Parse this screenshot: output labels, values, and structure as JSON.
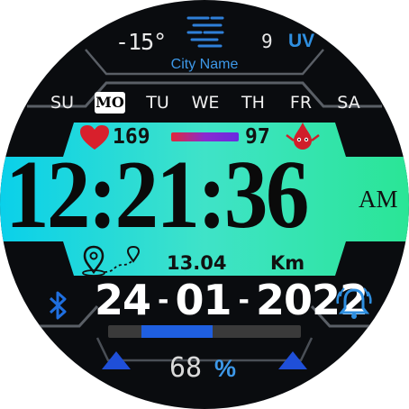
{
  "weather": {
    "temperature": "-15°",
    "uv_value": "9",
    "uv_label": "UV",
    "city": "City Name",
    "icon": "fog-icon"
  },
  "weekdays": [
    "SU",
    "MO",
    "TU",
    "WE",
    "TH",
    "FR",
    "SA"
  ],
  "active_day": "MO",
  "health": {
    "heart_rate": "169",
    "heart_icon": "heart-icon",
    "oxygen": "97",
    "oxygen_icon": "blood-drop-icon"
  },
  "time": {
    "display": "12:21:36",
    "ampm": "AM"
  },
  "distance": {
    "value": "13.04",
    "unit": "Km",
    "icon": "route-pin-icon"
  },
  "date": {
    "day": "24",
    "month": "01",
    "year": "2022",
    "separator": "-"
  },
  "battery": {
    "percent_value": "68",
    "percent_sign": "%",
    "level": 0.68
  },
  "icons": {
    "bluetooth": "bluetooth-icon",
    "alarm": "alarm-bell-icon",
    "left_arrow": "triangle-up-icon",
    "right_arrow": "triangle-up-icon"
  },
  "colors": {
    "accent_blue": "#2f8fe0",
    "band_start": "#00c8e8",
    "band_end": "#2ee39a",
    "battery_fill": "#1f5fe0"
  }
}
